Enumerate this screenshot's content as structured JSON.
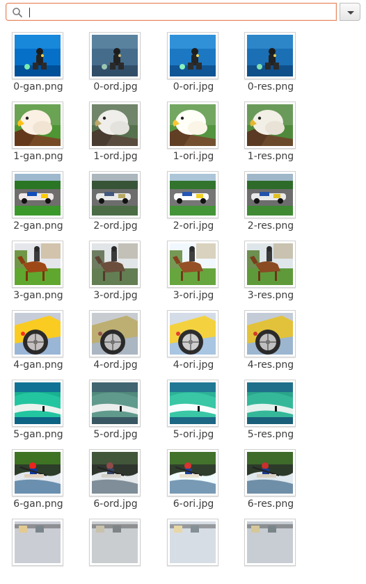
{
  "search": {
    "value": "",
    "placeholder": ""
  },
  "icons": {
    "search": "search-icon",
    "dropdown": "chevron-down-icon"
  },
  "files": [
    {
      "name": "0-gan.png",
      "theme": "diver",
      "variant": "gan"
    },
    {
      "name": "0-ord.jpg",
      "theme": "diver",
      "variant": "ord"
    },
    {
      "name": "0-ori.jpg",
      "theme": "diver",
      "variant": "ori"
    },
    {
      "name": "0-res.png",
      "theme": "diver",
      "variant": "res"
    },
    {
      "name": "1-gan.png",
      "theme": "eagle",
      "variant": "gan"
    },
    {
      "name": "1-ord.jpg",
      "theme": "eagle",
      "variant": "ord"
    },
    {
      "name": "1-ori.jpg",
      "theme": "eagle",
      "variant": "ori"
    },
    {
      "name": "1-res.png",
      "theme": "eagle",
      "variant": "res"
    },
    {
      "name": "2-gan.png",
      "theme": "racecar",
      "variant": "gan"
    },
    {
      "name": "2-ord.jpg",
      "theme": "racecar",
      "variant": "ord"
    },
    {
      "name": "2-ori.jpg",
      "theme": "racecar",
      "variant": "ori"
    },
    {
      "name": "2-res.png",
      "theme": "racecar",
      "variant": "res"
    },
    {
      "name": "3-gan.png",
      "theme": "horse",
      "variant": "gan"
    },
    {
      "name": "3-ord.jpg",
      "theme": "horse",
      "variant": "ord"
    },
    {
      "name": "3-ori.jpg",
      "theme": "horse",
      "variant": "ori"
    },
    {
      "name": "3-res.png",
      "theme": "horse",
      "variant": "res"
    },
    {
      "name": "4-gan.png",
      "theme": "wheel",
      "variant": "gan"
    },
    {
      "name": "4-ord.jpg",
      "theme": "wheel",
      "variant": "ord"
    },
    {
      "name": "4-ori.jpg",
      "theme": "wheel",
      "variant": "ori"
    },
    {
      "name": "4-res.png",
      "theme": "wheel",
      "variant": "res"
    },
    {
      "name": "5-gan.png",
      "theme": "wave",
      "variant": "gan"
    },
    {
      "name": "5-ord.jpg",
      "theme": "wave",
      "variant": "ord"
    },
    {
      "name": "5-ori.jpg",
      "theme": "wave",
      "variant": "ori"
    },
    {
      "name": "5-res.png",
      "theme": "wave",
      "variant": "res"
    },
    {
      "name": "6-gan.png",
      "theme": "kayak",
      "variant": "gan"
    },
    {
      "name": "6-ord.jpg",
      "theme": "kayak",
      "variant": "ord"
    },
    {
      "name": "6-ori.jpg",
      "theme": "kayak",
      "variant": "ori"
    },
    {
      "name": "6-res.png",
      "theme": "kayak",
      "variant": "res"
    },
    {
      "name": "",
      "theme": "street",
      "variant": "gan"
    },
    {
      "name": "",
      "theme": "street",
      "variant": "ord"
    },
    {
      "name": "",
      "theme": "street",
      "variant": "ori"
    },
    {
      "name": "",
      "theme": "street",
      "variant": "res"
    }
  ]
}
